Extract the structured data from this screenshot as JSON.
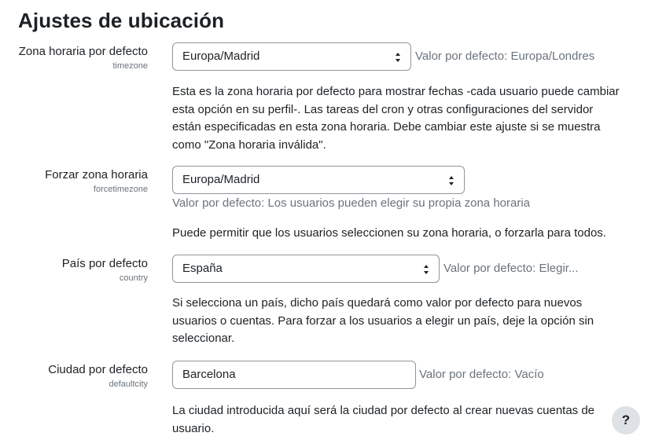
{
  "page": {
    "title": "Ajustes de ubicación"
  },
  "settings": [
    {
      "label": "Zona horaria por defecto",
      "name": "timezone",
      "value": "Europa/Madrid",
      "default_text": "Valor por defecto: Europa/Londres",
      "description": "Esta es la zona horaria por defecto para mostrar fechas -cada usuario puede cambiar esta opción en su perfil-. Las tareas del cron y otras configuraciones del servidor están especificadas en esta zona horaria. Debe cambiar este ajuste si se muestra como \"Zona horaria inválida\"."
    },
    {
      "label": "Forzar zona horaria",
      "name": "forcetimezone",
      "value": "Europa/Madrid",
      "default_text": "Valor por defecto: Los usuarios pueden elegir su propia zona horaria",
      "description": "Puede permitir que los usuarios seleccionen su zona horaria, o forzarla para todos."
    },
    {
      "label": "País por defecto",
      "name": "country",
      "value": "España",
      "default_text": "Valor por defecto: Elegir...",
      "description": "Si selecciona un país, dicho país quedará como valor por defecto para nuevos usuarios o cuentas. Para forzar a los usuarios a elegir un país, deje la opción sin seleccionar."
    },
    {
      "label": "Ciudad por defecto",
      "name": "defaultcity",
      "value": "Barcelona",
      "default_text": "Valor por defecto: Vacío",
      "description": "La ciudad introducida aquí será la ciudad por defecto al crear nuevas cuentas de usuario."
    }
  ],
  "help_button": {
    "label": "?"
  }
}
